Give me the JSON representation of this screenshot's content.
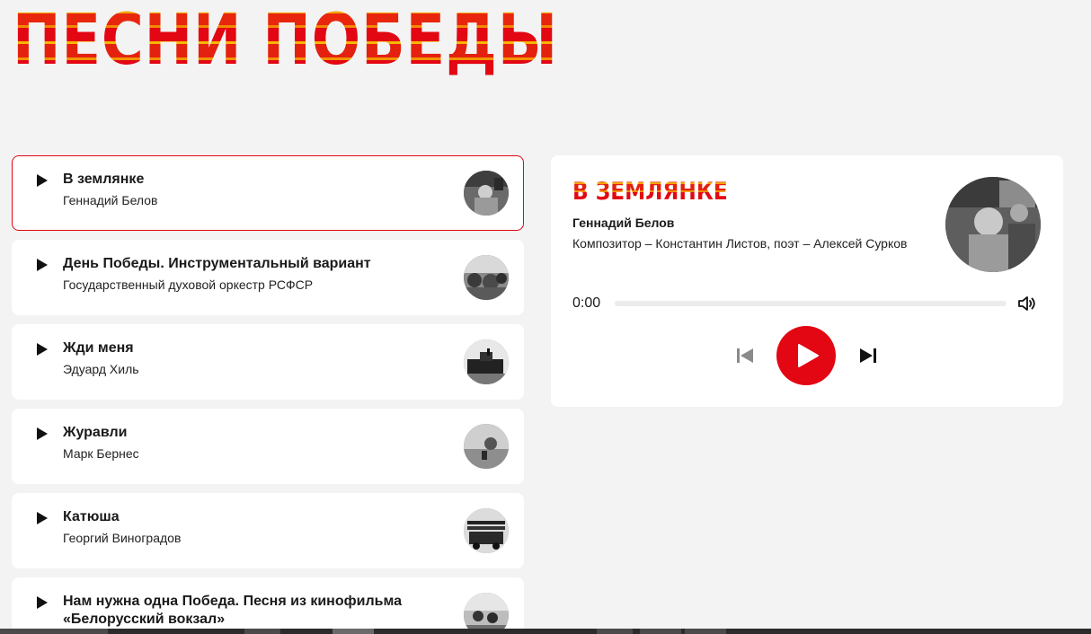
{
  "header": {
    "title": "ПЕСНИ ПОБЕДЫ"
  },
  "tracks": [
    {
      "title": "В землянке",
      "artist": "Геннадий Белов",
      "active": true
    },
    {
      "title": "День Победы. Инструментальный вариант",
      "artist": "Государственный духовой оркестр РСФСР"
    },
    {
      "title": "Жди меня",
      "artist": "Эдуард Хиль"
    },
    {
      "title": "Журавли",
      "artist": "Марк Бернес"
    },
    {
      "title": "Катюша",
      "artist": "Георгий Виноградов"
    },
    {
      "title": "Нам нужна одна Победа. Песня из кинофильма «Белорусский вокзал»",
      "artist": ""
    }
  ],
  "player": {
    "title": "В ЗЕМЛЯНКЕ",
    "artist": "Геннадий Белов",
    "description": "Композитор – Константин Листов, поэт – Алексей Сурков",
    "time": "0:00",
    "progress": 0
  },
  "icons": {
    "track_play": "play-icon",
    "volume": "volume-icon",
    "prev": "skip-previous-icon",
    "play": "play-icon",
    "next": "skip-next-icon"
  },
  "colors": {
    "accent": "#e30613",
    "accent_alt": "#f5a300",
    "background": "#f3f3f3",
    "card": "#ffffff"
  }
}
